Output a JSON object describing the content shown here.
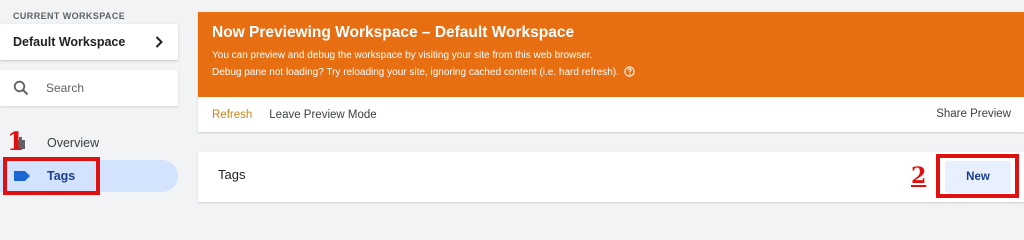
{
  "sidebar": {
    "workspace_label": "CURRENT WORKSPACE",
    "workspace_name": "Default Workspace",
    "search_placeholder": "Search",
    "nav": {
      "overview": "Overview",
      "tags": "Tags"
    }
  },
  "preview_banner": {
    "title": "Now Previewing Workspace – Default Workspace",
    "line1": "You can preview and debug the workspace by visiting your site from this web browser.",
    "line2": "Debug pane not loading? Try reloading your site, ignoring cached content (i.e. hard refresh).",
    "actions": {
      "refresh": "Refresh",
      "leave": "Leave Preview Mode",
      "share": "Share Preview"
    },
    "color": "#e86e12"
  },
  "tags_panel": {
    "title": "Tags",
    "new_button": "New"
  },
  "annotations": {
    "step1": "1",
    "step2": "2",
    "color": "#e01010"
  },
  "icons": [
    "chevron-right-icon",
    "search-icon",
    "overview-icon",
    "tag-icon",
    "help-circle-icon"
  ]
}
